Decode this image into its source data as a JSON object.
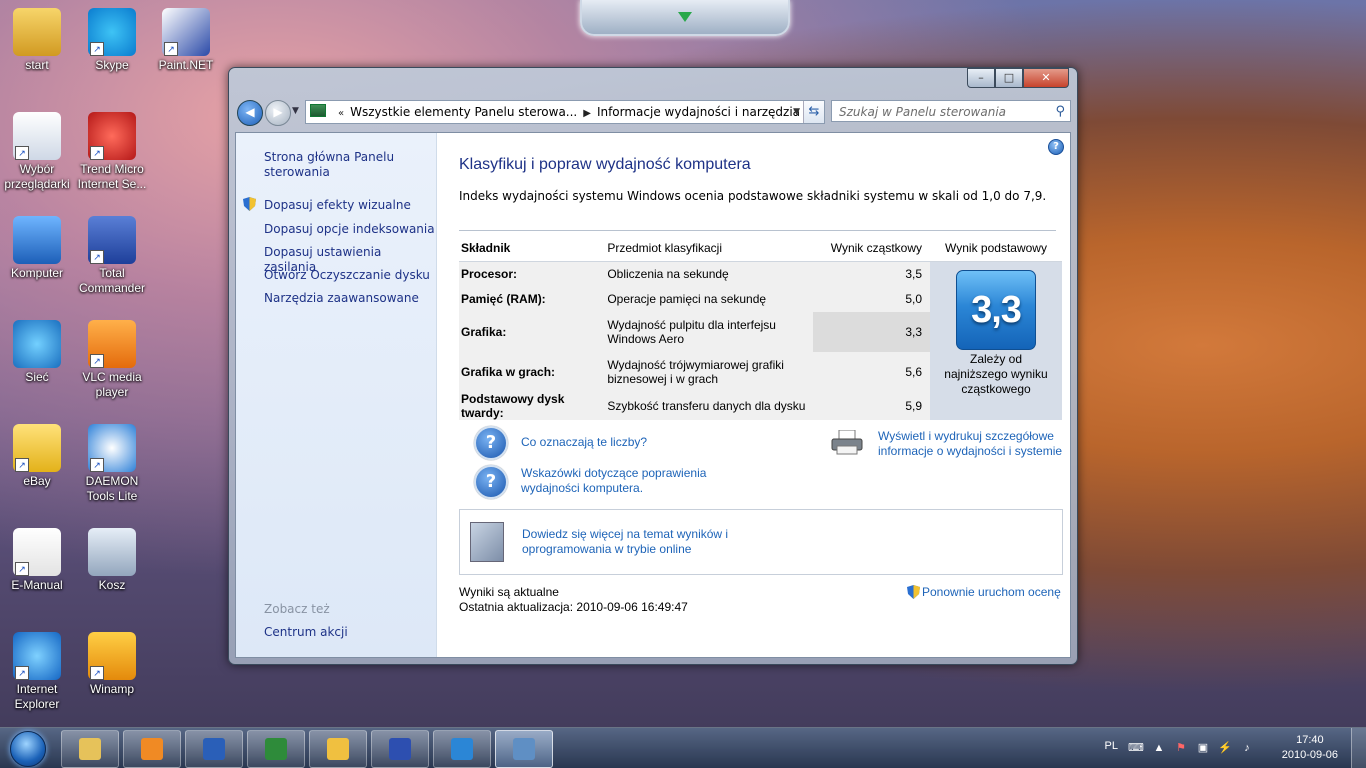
{
  "desktop": {
    "icons": [
      {
        "label": "start",
        "icon": "folder-user-icon"
      },
      {
        "label": "Skype",
        "icon": "skype-icon"
      },
      {
        "label": "Paint.NET",
        "icon": "paintnet-icon"
      },
      {
        "label": "Wybór\nprzeglądarki",
        "icon": "browser-choice-icon"
      },
      {
        "label": "Trend Micro\nInternet Se...",
        "icon": "trend-micro-icon"
      },
      {
        "label": "Komputer",
        "icon": "computer-icon"
      },
      {
        "label": "Total\nCommander",
        "icon": "floppy-icon"
      },
      {
        "label": "Sieć",
        "icon": "network-icon"
      },
      {
        "label": "VLC media\nplayer",
        "icon": "vlc-icon"
      },
      {
        "label": "eBay",
        "icon": "ebay-icon"
      },
      {
        "label": "DAEMON\nTools Lite",
        "icon": "daemon-tools-icon"
      },
      {
        "label": "E-Manual",
        "icon": "pdf-icon"
      },
      {
        "label": "Kosz",
        "icon": "recycle-bin-icon"
      },
      {
        "label": "Internet\nExplorer",
        "icon": "ie-icon"
      },
      {
        "label": "Winamp",
        "icon": "winamp-icon"
      }
    ]
  },
  "window": {
    "breadcrumb": {
      "part1": "Wszystkie elementy Panelu sterowa...",
      "part2": "Informacje wydajności i narzędzia"
    },
    "search_placeholder": "Szukaj w Panelu sterowania",
    "caption": {
      "minimize": "–",
      "maximize": "□",
      "close": "✕"
    }
  },
  "sidebar": {
    "home_link": "Strona główna Panelu sterowania",
    "links": [
      "Dopasuj efekty wizualne",
      "Dopasuj opcje indeksowania",
      "Dopasuj ustawienia zasilania",
      "Otwórz Oczyszczanie dysku",
      "Narzędzia zaawansowane"
    ],
    "see_also_title": "Zobacz też",
    "see_also_link": "Centrum akcji"
  },
  "main": {
    "title": "Klasyfikuj i popraw wydajność komputera",
    "intro": "Indeks wydajności systemu Windows ocenia podstawowe składniki systemu w skali od 1,0 do 7,9.",
    "table": {
      "headers": [
        "Składnik",
        "Przedmiot klasyfikacji",
        "Wynik cząstkowy",
        "Wynik podstawowy"
      ],
      "rows": [
        {
          "component": "Procesor:",
          "subject": "Obliczenia na sekundę",
          "score": "3,5"
        },
        {
          "component": "Pamięć (RAM):",
          "subject": "Operacje pamięci na sekundę",
          "score": "5,0"
        },
        {
          "component": "Grafika:",
          "subject": "Wydajność pulpitu dla interfejsu Windows Aero",
          "score": "3,3"
        },
        {
          "component": "Grafika w grach:",
          "subject": "Wydajność trójwymiarowej grafiki biznesowej i w grach",
          "score": "5,6"
        },
        {
          "component": "Podstawowy dysk twardy:",
          "subject": "Szybkość transferu danych dla dysku",
          "score": "5,9"
        }
      ],
      "base_score": "3,3",
      "base_note": "Zależy od najniższego wyniku cząstkowego"
    },
    "links": {
      "what_mean": "Co oznaczają te liczby?",
      "tips": "Wskazówki dotyczące poprawienia wydajności komputera.",
      "print": "Wyświetl i wydrukuj szczegółowe informacje o wydajności i systemie",
      "learn_more": "Dowiedz się więcej na temat wyników i oprogramowania w trybie online",
      "rerun": "Ponownie uruchom ocenę"
    },
    "status": {
      "line1": "Wyniki są aktualne",
      "line2": "Ostatnia aktualizacja: 2010-09-06 16:49:47"
    }
  },
  "taskbar": {
    "pinned": [
      {
        "name": "explorer",
        "icon": "folder-icon"
      },
      {
        "name": "media-player",
        "icon": "media-player-icon"
      },
      {
        "name": "word",
        "icon": "word-icon"
      },
      {
        "name": "excel",
        "icon": "excel-icon"
      },
      {
        "name": "outlook",
        "icon": "outlook-icon"
      },
      {
        "name": "total-commander",
        "icon": "floppy-icon"
      },
      {
        "name": "internet-explorer",
        "icon": "ie-icon"
      },
      {
        "name": "control-panel",
        "icon": "control-panel-icon",
        "active": true
      }
    ],
    "tray": {
      "language": "PL",
      "time": "17:40",
      "date": "2010-09-06"
    }
  },
  "colors": {
    "link": "#1e64b8",
    "heading": "#1e3287",
    "badge": "#2b86d6"
  }
}
